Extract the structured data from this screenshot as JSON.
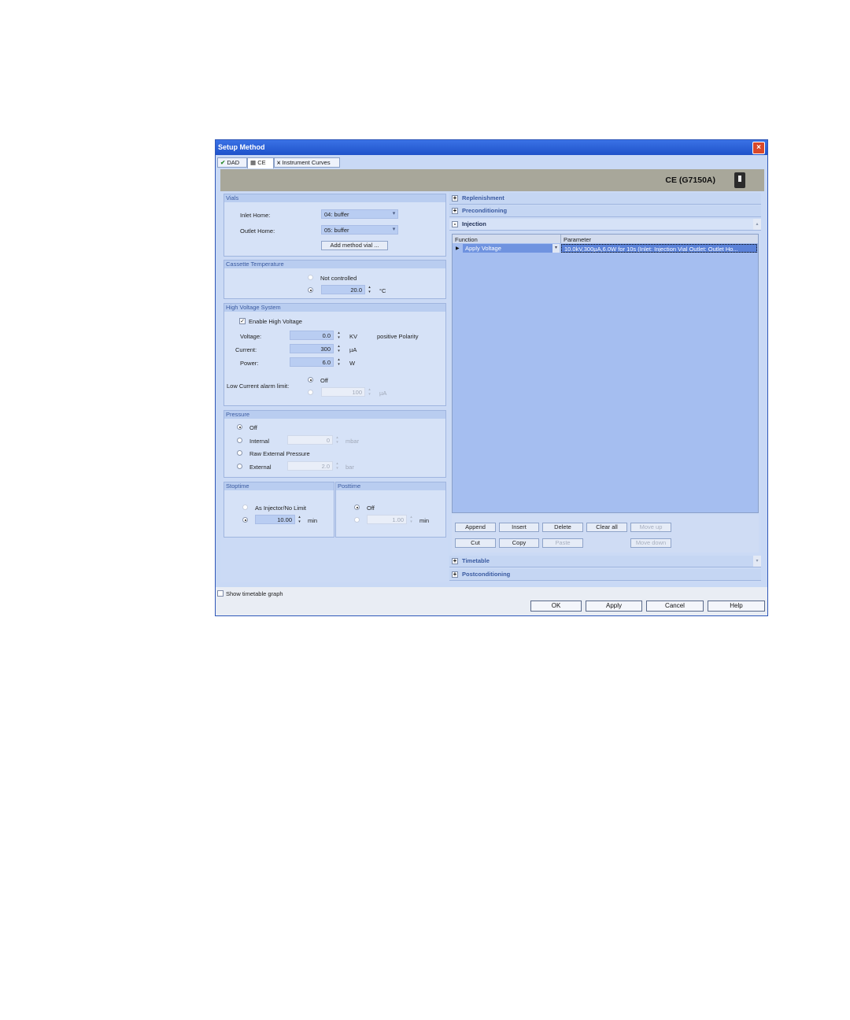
{
  "window": {
    "title": "Setup Method",
    "close": "×"
  },
  "tabs": [
    {
      "label": "DAD"
    },
    {
      "label": "CE"
    },
    {
      "label": "Instrument Curves"
    }
  ],
  "header": {
    "model": "CE (G7150A)"
  },
  "vials": {
    "title": "Vials",
    "inlet_label": "Inlet Home:",
    "inlet_value": "04: buffer",
    "outlet_label": "Outlet Home:",
    "outlet_value": "05: buffer",
    "add_button": "Add method vial ..."
  },
  "cassette": {
    "title": "Cassette Temperature",
    "not_controlled": "Not controlled",
    "value": "20.0",
    "unit": "°C"
  },
  "hv": {
    "title": "High Voltage System",
    "enable_label": "Enable High Voltage",
    "voltage_label": "Voltage:",
    "voltage_value": "0.0",
    "voltage_unit": "KV",
    "polarity": "positive Polarity",
    "current_label": "Current:",
    "current_value": "300",
    "current_unit": "µA",
    "power_label": "Power:",
    "power_value": "6.0",
    "power_unit": "W",
    "alarm_label": "Low Current alarm limit:",
    "alarm_off": "Off",
    "alarm_value": "100",
    "alarm_unit": "µA"
  },
  "pressure": {
    "title": "Pressure",
    "off": "Off",
    "internal": "Internal",
    "internal_value": "0",
    "internal_unit": "mbar",
    "raw_external": "Raw External Pressure",
    "external": "External",
    "external_value": "2.0",
    "external_unit": "bar"
  },
  "stoptime": {
    "title": "Stoptime",
    "as_injector": "As Injector/No Limit",
    "value": "10.00",
    "unit": "min"
  },
  "posttime": {
    "title": "Posttime",
    "off": "Off",
    "value": "1.00",
    "unit": "min"
  },
  "sections": {
    "replenishment": "Replenishment",
    "preconditioning": "Preconditioning",
    "injection": "Injection",
    "timetable": "Timetable",
    "postconditioning": "Postconditioning"
  },
  "injection_table": {
    "col_function": "Function",
    "col_parameter": "Parameter",
    "row_function": "Apply Voltage",
    "row_parameter": "10.0kV,300µA,6.0W for 10s (Inlet: Injection Vial Outlet: Outlet Ho..."
  },
  "table_buttons": {
    "append": "Append",
    "insert": "Insert",
    "delete": "Delete",
    "clear_all": "Clear all",
    "move_up": "Move up",
    "cut": "Cut",
    "copy": "Copy",
    "paste": "Paste",
    "move_down": "Move down"
  },
  "footer": {
    "show_graph": "Show timetable graph",
    "ok": "OK",
    "apply": "Apply",
    "cancel": "Cancel",
    "help": "Help"
  },
  "colors": {
    "title_bar": "#2b5fd6",
    "close": "#d9482b",
    "panel": "#d6e2f7",
    "field": "#b9cdf2",
    "header_band": "#a8a79a"
  }
}
